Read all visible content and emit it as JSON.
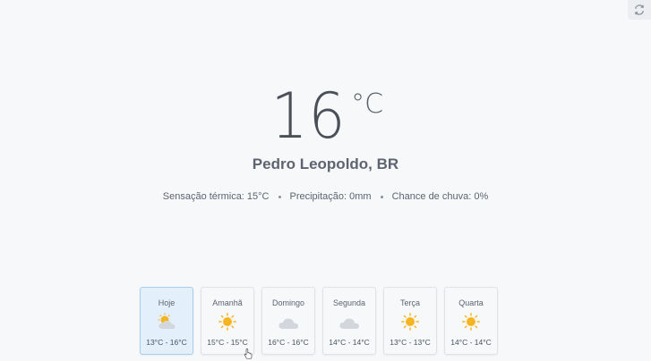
{
  "current": {
    "temperature": "16",
    "unit": "°C",
    "location": "Pedro Leopoldo, BR",
    "feels_like": "Sensação térmica: 15°C",
    "precipitation": "Precipitação: 0mm",
    "rain_chance": "Chance de chuva: 0%"
  },
  "forecast": [
    {
      "day": "Hoje",
      "range": "13°C - 16°C",
      "icon": "partly-cloudy-icon"
    },
    {
      "day": "Amanhã",
      "range": "15°C - 15°C",
      "icon": "sun-icon"
    },
    {
      "day": "Domingo",
      "range": "16°C - 16°C",
      "icon": "cloud-icon"
    },
    {
      "day": "Segunda",
      "range": "14°C - 14°C",
      "icon": "cloud-icon"
    },
    {
      "day": "Terça",
      "range": "13°C - 13°C",
      "icon": "sun-icon"
    },
    {
      "day": "Quarta",
      "range": "14°C - 14°C",
      "icon": "sun-icon"
    }
  ],
  "colors": {
    "active_card": "#e3f0fb",
    "sun": "#f5b520",
    "cloud": "#d3d7dd"
  }
}
